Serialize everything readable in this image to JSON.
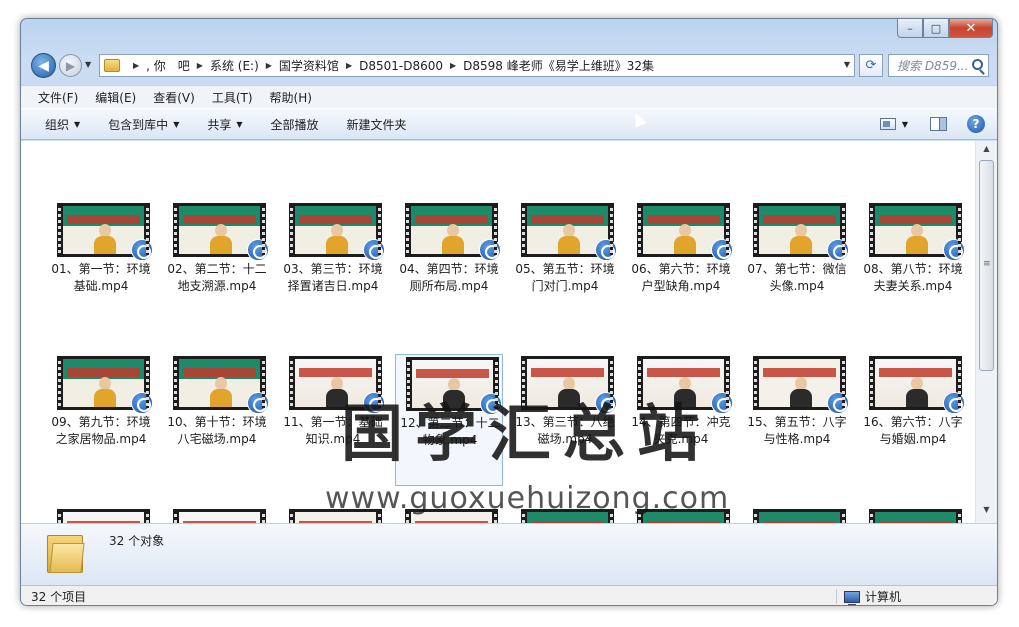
{
  "window": {
    "buttons": {
      "minimize": "–",
      "maximize": "□",
      "close": "✕"
    }
  },
  "address": {
    "crumbs": [
      ", 你　吧",
      "系统 (E:)",
      "国学资料馆",
      "D8501-D8600",
      "D8598 峰老师《易学上维班》32集"
    ],
    "search_placeholder": "搜索 D859..."
  },
  "menu": [
    "文件(F)",
    "编辑(E)",
    "查看(V)",
    "工具(T)",
    "帮助(H)"
  ],
  "commands": [
    {
      "label": "组织",
      "dropdown": true
    },
    {
      "label": "包含到库中",
      "dropdown": true
    },
    {
      "label": "共享",
      "dropdown": true
    },
    {
      "label": "全部播放",
      "dropdown": false
    },
    {
      "label": "新建文件夹",
      "dropdown": false
    }
  ],
  "files": [
    {
      "name": "01、第一节：环境基础.mp4",
      "style": "green"
    },
    {
      "name": "02、第二节：十二地支溯源.mp4",
      "style": "green"
    },
    {
      "name": "03、第三节：环境择置诸吉日.mp4",
      "style": "green"
    },
    {
      "name": "04、第四节：环境厕所布局.mp4",
      "style": "green"
    },
    {
      "name": "05、第五节：环境门对门.mp4",
      "style": "green"
    },
    {
      "name": "06、第六节：环境户型缺角.mp4",
      "style": "green"
    },
    {
      "name": "07、第七节：微信头像.mp4",
      "style": "green"
    },
    {
      "name": "08、第八节：环境夫妻关系.mp4",
      "style": "green"
    },
    {
      "name": "09、第九节：环境之家居物品.mp4",
      "style": "green"
    },
    {
      "name": "10、第十节：环境八宅磁场.mp4",
      "style": "green"
    },
    {
      "name": "11、第一节：基础知识.mp4",
      "style": "red"
    },
    {
      "name": "12、第二节：十二物象.mp4",
      "style": "red",
      "selected": true
    },
    {
      "name": "13、第三节：八绝磁场.mp4",
      "style": "red"
    },
    {
      "name": "14、第四节：冲克夹克.mp4",
      "style": "red"
    },
    {
      "name": "15、第五节：八字与性格.mp4",
      "style": "white"
    },
    {
      "name": "16、第六节：八字与婚姻.mp4",
      "style": "red"
    },
    {
      "name": "",
      "style": "red"
    },
    {
      "name": "",
      "style": "red"
    },
    {
      "name": "",
      "style": "white"
    },
    {
      "name": "",
      "style": "white"
    },
    {
      "name": "",
      "style": "green"
    },
    {
      "name": "",
      "style": "green"
    },
    {
      "name": "",
      "style": "green"
    },
    {
      "name": "",
      "style": "green"
    }
  ],
  "watermark": {
    "title": "国学汇总站",
    "url": "www.guoxuehuizong.com"
  },
  "details": {
    "count": "32 个对象"
  },
  "status": {
    "items": "32 个项目",
    "location": "计算机"
  }
}
